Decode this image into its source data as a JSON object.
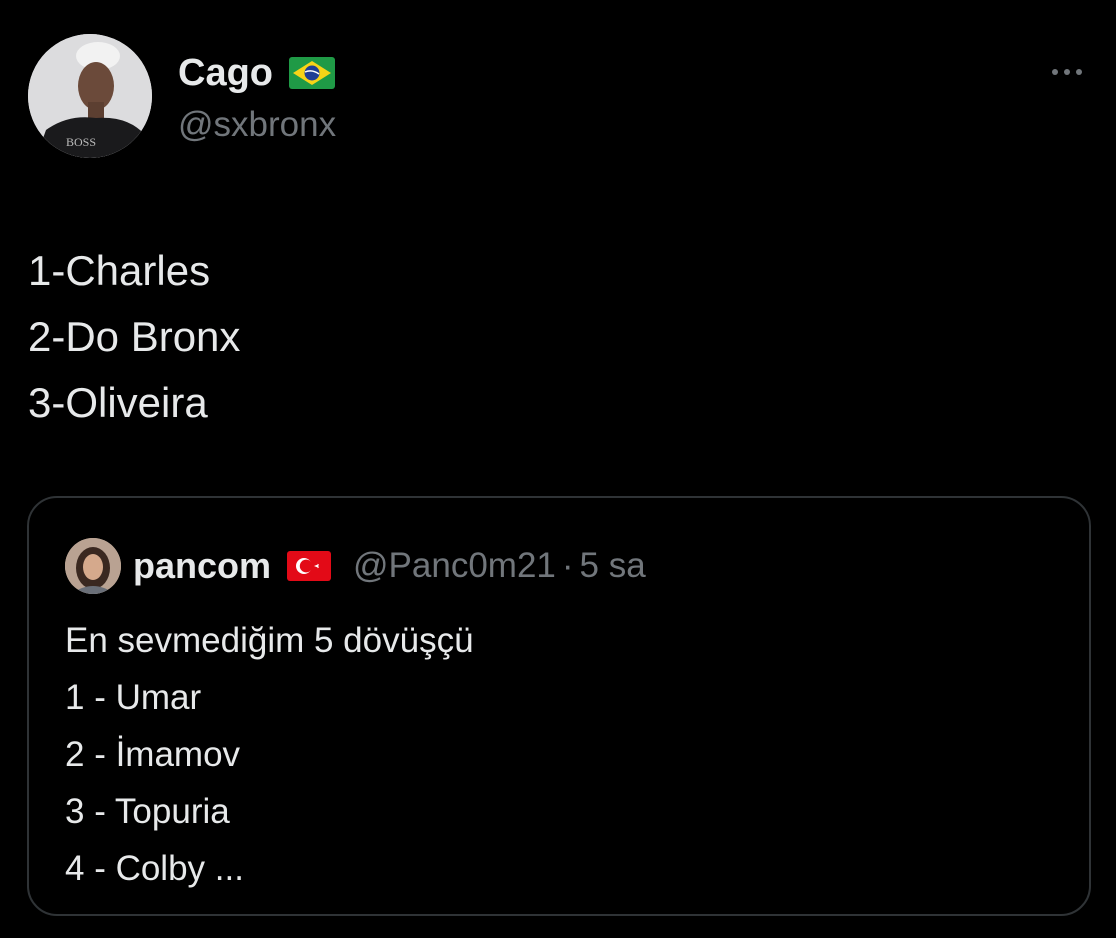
{
  "tweet": {
    "author": {
      "name": "Cago",
      "handle": "@sxbronx",
      "flag_icon": "brazil-flag-icon"
    },
    "more_icon": "more-options-icon",
    "lines": [
      "1-Charles",
      "2-Do Bronx",
      "3-Oliveira"
    ]
  },
  "quoted_tweet": {
    "author": {
      "name": "pancom",
      "handle": "@Panc0m21",
      "separator": "·",
      "time": "5 sa",
      "flag_icon": "turkey-flag-icon"
    },
    "lines": [
      "En sevmediğim 5 dövüşçü",
      "1 - Umar",
      "2 - İmamov",
      "3 - Topuria",
      "4 - Colby ..."
    ]
  },
  "colors": {
    "background": "#000000",
    "primary_text": "#e7e9ea",
    "secondary_text": "#71767b",
    "border": "#2f3336"
  }
}
